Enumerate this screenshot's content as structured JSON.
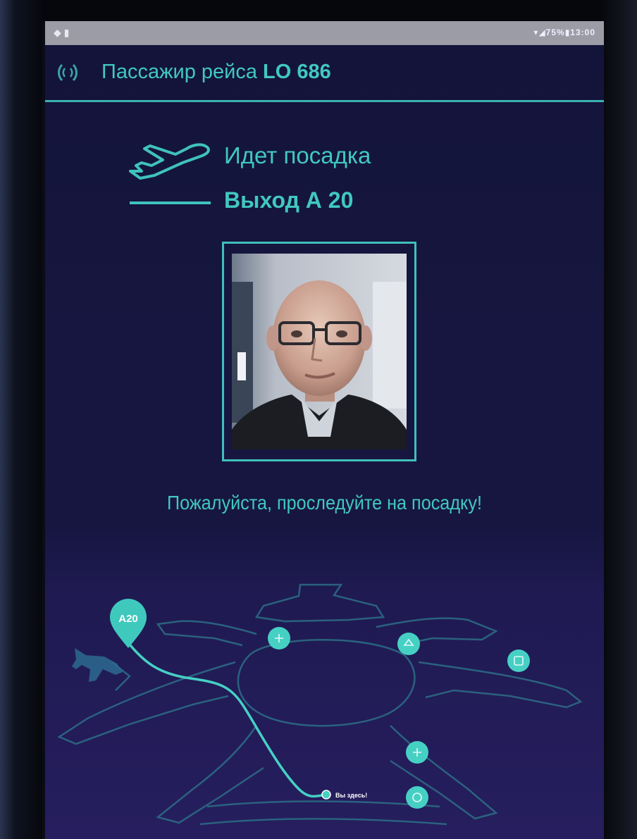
{
  "status_bar": {
    "left": "◆ ▮",
    "right": "▾◢75%▮13:00"
  },
  "header": {
    "title_prefix": "Пассажир рейса",
    "flight_number": "LO 686"
  },
  "flight_status": {
    "boarding": "Идет посадка",
    "gate": "Выход А 20"
  },
  "message": "Пожалуйста, проследуйте на посадку!",
  "map": {
    "gate_pin": "A20",
    "you_are_here": "Вы здесь!"
  },
  "colors": {
    "accent": "#41c8c0",
    "background": "#14143c",
    "status_bar": "#9c9ca6"
  }
}
